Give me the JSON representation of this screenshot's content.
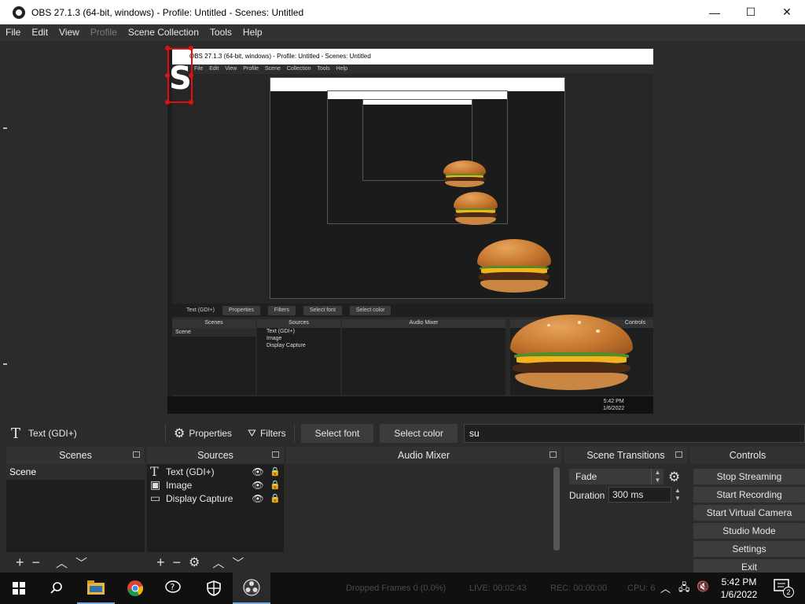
{
  "window": {
    "title": "OBS 27.1.3 (64-bit, windows) - Profile: Untitled - Scenes: Untitled",
    "minimize": "—",
    "maximize": "☐",
    "close": "✕"
  },
  "menu": [
    {
      "label": "File",
      "disabled": false
    },
    {
      "label": "Edit",
      "disabled": false
    },
    {
      "label": "View",
      "disabled": false
    },
    {
      "label": "Profile",
      "disabled": true
    },
    {
      "label": "Scene Collection",
      "disabled": false
    },
    {
      "label": "Tools",
      "disabled": false
    },
    {
      "label": "Help",
      "disabled": false
    }
  ],
  "preview": {
    "selected_text": "S",
    "nested_title": "OBS 27.1.3 (64-bit, windows) - Profile: Untitled - Scenes: Untitled",
    "nested_menu": "File Edit View Profile Scene Collection Tools Help",
    "nested_source": "Text (GDI+)",
    "nested_properties": "Properties",
    "nested_filters": "Filters",
    "nested_select_font": "Select font",
    "nested_select_color": "Select color",
    "nested_scenes": "Scenes",
    "nested_sources": "Sources",
    "nested_mixer": "Audio Mixer",
    "nested_controls": "Controls",
    "nested_scene_item": "Scene",
    "nested_sources_list": [
      "Text (GDI+)",
      "Image",
      "Display Capture"
    ],
    "nested_clock_time": "5:42 PM",
    "nested_clock_date": "1/6/2022"
  },
  "properties_bar": {
    "source_icon": "T",
    "source_name": "Text (GDI+)",
    "properties_label": "Properties",
    "filters_label": "Filters",
    "select_font_label": "Select font",
    "select_color_label": "Select color",
    "text_value": "su"
  },
  "docks": {
    "scenes": {
      "title": "Scenes",
      "items": [
        "Scene"
      ]
    },
    "sources": {
      "title": "Sources",
      "items": [
        {
          "icon": "text-icon",
          "label": "Text (GDI+)"
        },
        {
          "icon": "image-icon",
          "label": "Image"
        },
        {
          "icon": "monitor-icon",
          "label": "Display Capture"
        }
      ]
    },
    "mixer": {
      "title": "Audio Mixer"
    },
    "transitions": {
      "title": "Scene Transitions",
      "selected": "Fade",
      "duration_label": "Duration",
      "duration_value": "300 ms"
    },
    "controls": {
      "title": "Controls",
      "buttons": [
        "Stop Streaming",
        "Start Recording",
        "Start Virtual Camera",
        "Studio Mode",
        "Settings",
        "Exit"
      ]
    }
  },
  "status_bar": {
    "dropped": "Dropped Frames 0 (0.0%)",
    "live": "LIVE: 00:02:43",
    "rec": "REC: 00:00:00",
    "cpu": "CPU: 6"
  },
  "taskbar": {
    "clock_time": "5:42 PM",
    "clock_date": "1/6/2022",
    "notification_count": "2"
  }
}
